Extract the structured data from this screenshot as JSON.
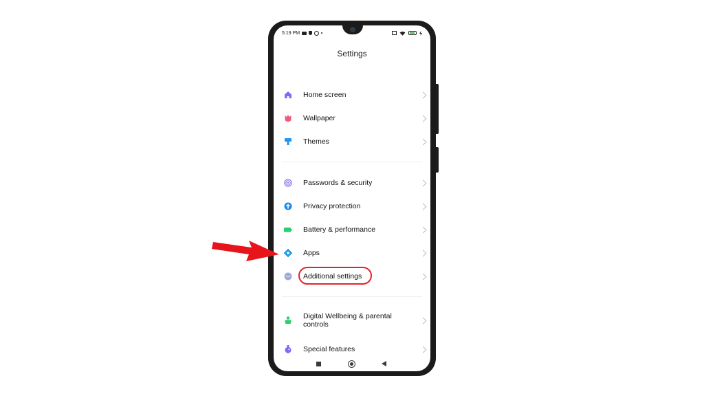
{
  "status_bar": {
    "time": "5:19 PM"
  },
  "header": {
    "title": "Settings"
  },
  "sections": [
    {
      "items": [
        {
          "label": "Home screen",
          "icon": "home-icon",
          "color": "#7b6cf6"
        },
        {
          "label": "Wallpaper",
          "icon": "tulip-icon",
          "color": "#ef5b7a"
        },
        {
          "label": "Themes",
          "icon": "brush-icon",
          "color": "#2196f3"
        }
      ]
    },
    {
      "items": [
        {
          "label": "Passwords & security",
          "icon": "fingerprint-icon",
          "color": "#8c7cf0"
        },
        {
          "label": "Privacy protection",
          "icon": "privacy-icon",
          "color": "#1e88e5"
        },
        {
          "label": "Battery & performance",
          "icon": "battery-icon",
          "color": "#2ecc71"
        },
        {
          "label": "Apps",
          "icon": "gear-icon",
          "color": "#1e9be9"
        },
        {
          "label": "Additional settings",
          "icon": "more-icon",
          "color": "#9fa8da"
        }
      ]
    },
    {
      "items": [
        {
          "label": "Digital Wellbeing & parental controls",
          "icon": "wellbeing-icon",
          "color": "#2ecc71"
        },
        {
          "label": "Special features",
          "icon": "potion-icon",
          "color": "#7b6cf6"
        }
      ]
    }
  ],
  "annotation": {
    "highlight_color": "#e3232a"
  }
}
